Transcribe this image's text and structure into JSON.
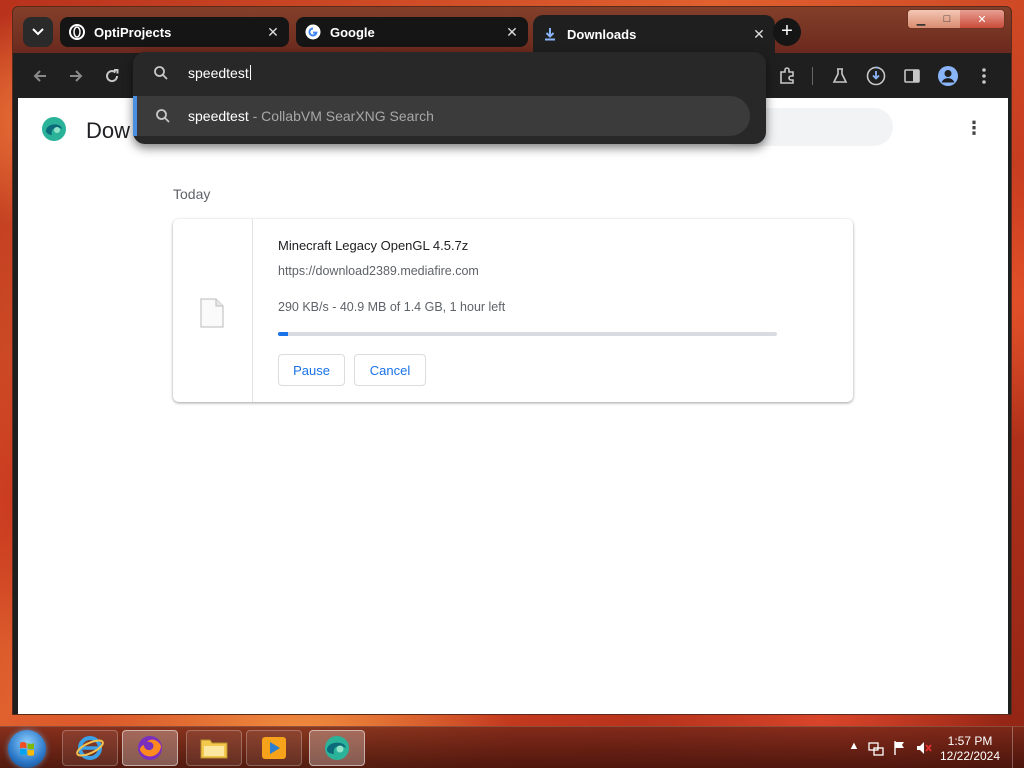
{
  "browser": {
    "tabs": [
      {
        "label": "OptiProjects",
        "icon": "optiprojects-icon"
      },
      {
        "label": "Google",
        "icon": "google-icon"
      },
      {
        "label": "Downloads",
        "icon": "download-icon",
        "active": true
      }
    ],
    "window_controls": {
      "minimize": "minimize-icon",
      "maximize": "maximize-icon",
      "close": "close-icon"
    }
  },
  "omnibox": {
    "query": "speedtest",
    "suggestion": {
      "text": "speedtest",
      "separator": " - ",
      "engine": "CollabVM SearXNG Search"
    }
  },
  "page": {
    "title": "Dow",
    "section": "Today",
    "download": {
      "name": "Minecraft Legacy OpenGL 4.5.7z",
      "url": "https://download2389.mediafire.com",
      "status": "290 KB/s - 40.9 MB of 1.4 GB, 1 hour left",
      "progress_fraction": 0.02,
      "pause_label": "Pause",
      "cancel_label": "Cancel"
    }
  },
  "taskbar": {
    "apps": [
      "internet-explorer-icon",
      "firefox-icon",
      "file-explorer-icon",
      "media-player-icon",
      "edge-icon"
    ],
    "clock": {
      "time": "1:57 PM",
      "date": "12/22/2024"
    }
  },
  "colors": {
    "accent": "#1a73e8",
    "omnibox_bg": "#282828",
    "suggest_bg": "#3b3b3b"
  }
}
